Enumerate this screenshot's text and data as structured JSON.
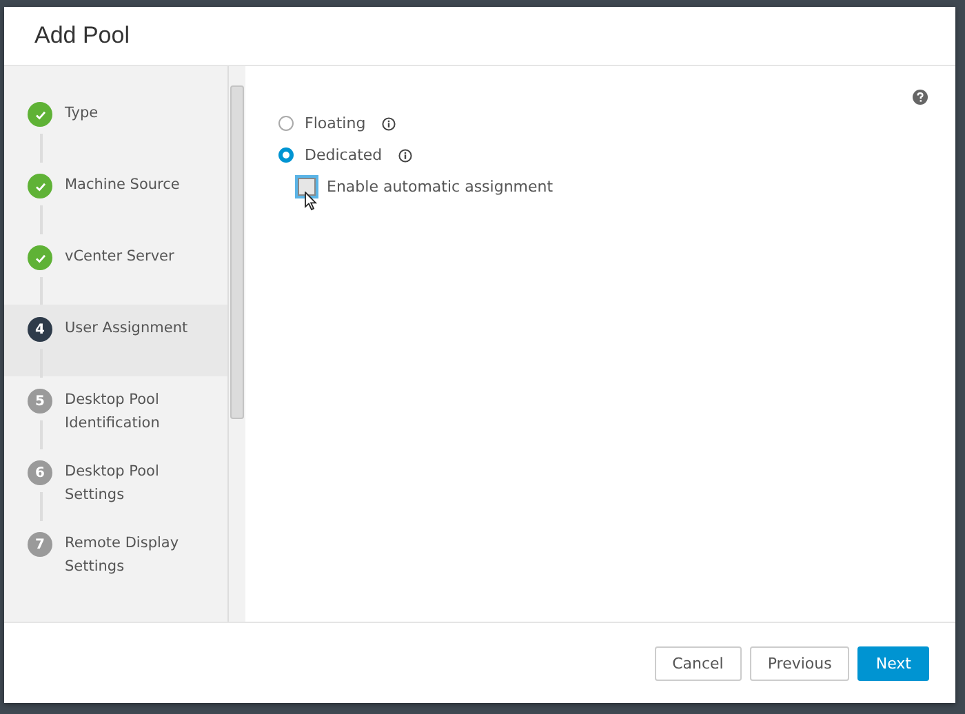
{
  "window": {
    "title": "Add Pool"
  },
  "steps": [
    {
      "label": "Type",
      "kind": "done"
    },
    {
      "label": "Machine Source",
      "kind": "done"
    },
    {
      "label": "vCenter Server",
      "kind": "done"
    },
    {
      "number": "4",
      "label": "User Assignment",
      "kind": "current"
    },
    {
      "number": "5",
      "label": "Desktop Pool Identification",
      "kind": "pending"
    },
    {
      "number": "6",
      "label": "Desktop Pool Settings",
      "kind": "pending"
    },
    {
      "number": "7",
      "label": "Remote Display Settings",
      "kind": "pending"
    }
  ],
  "options": [
    {
      "label": "Floating",
      "selected": false
    },
    {
      "label": "Dedicated",
      "selected": true
    }
  ],
  "auto_assignment": {
    "label": "Enable automatic assignment",
    "checked": false
  },
  "buttons": [
    {
      "label": "Cancel",
      "kind": "secondary"
    },
    {
      "label": "Previous",
      "kind": "secondary"
    },
    {
      "label": "Next",
      "kind": "primary"
    }
  ]
}
